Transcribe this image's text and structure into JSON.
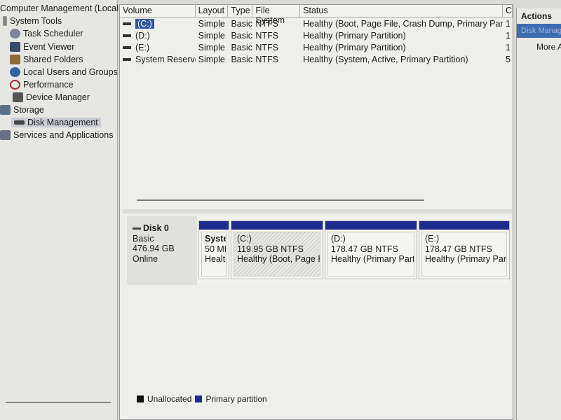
{
  "tree": {
    "root": "Computer Management (Local",
    "items": [
      {
        "label": "System Tools",
        "icon": "tools-icon"
      },
      {
        "label": "Task Scheduler",
        "icon": "clock-icon"
      },
      {
        "label": "Event Viewer",
        "icon": "event-viewer-icon"
      },
      {
        "label": "Shared Folders",
        "icon": "shared-folder-icon"
      },
      {
        "label": "Local Users and Groups",
        "icon": "users-icon"
      },
      {
        "label": "Performance",
        "icon": "performance-icon"
      },
      {
        "label": "Device Manager",
        "icon": "device-manager-icon"
      },
      {
        "label": "Storage",
        "icon": "storage-icon"
      },
      {
        "label": "Disk Management",
        "icon": "disk-icon",
        "selected": true
      },
      {
        "label": "Services and Applications",
        "icon": "services-icon"
      }
    ]
  },
  "volumes": {
    "headers": [
      "Volume",
      "Layout",
      "Type",
      "File System",
      "Status",
      "C"
    ],
    "rows": [
      [
        "(C:)",
        "Simple",
        "Basic",
        "NTFS",
        "Healthy (Boot, Page File, Crash Dump, Primary Partition)",
        "1"
      ],
      [
        "(D:)",
        "Simple",
        "Basic",
        "NTFS",
        "Healthy (Primary Partition)",
        "1"
      ],
      [
        "(E:)",
        "Simple",
        "Basic",
        "NTFS",
        "Healthy (Primary Partition)",
        "1"
      ],
      [
        "System Reserved",
        "Simple",
        "Basic",
        "NTFS",
        "Healthy (System, Active, Primary Partition)",
        "5"
      ]
    ]
  },
  "disk": {
    "name": "Disk 0",
    "type": "Basic",
    "size": "476.94 GB",
    "status": "Online",
    "partitions": [
      {
        "name": "Syster",
        "size": "50 MB",
        "status": "Healtl"
      },
      {
        "name": "(C:)",
        "size": "119.95 GB NTFS",
        "status": "Healthy (Boot, Page File,"
      },
      {
        "name": "(D:)",
        "size": "178.47 GB NTFS",
        "status": "Healthy (Primary Partitio"
      },
      {
        "name": "(E:)",
        "size": "178.47 GB NTFS",
        "status": "Healthy (Primary Partitio"
      }
    ]
  },
  "legend": {
    "unallocated": "Unallocated",
    "primary": "Primary partition",
    "colors": {
      "unallocated": "#111111",
      "primary": "#1d2b8f"
    }
  },
  "actions": {
    "title": "Actions",
    "selected": "Disk Manage",
    "more": "More A"
  }
}
